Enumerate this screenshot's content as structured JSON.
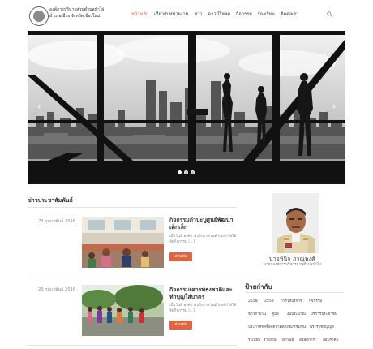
{
  "site": {
    "name_line1": "องค์การบริหารส่วนตำบลป่าไผ่",
    "name_line2": "อำเภอเมือง จังหวัดเชียงใหม่"
  },
  "nav": {
    "items": [
      "หน้าหลัก",
      "เกี่ยวกับหน่วยงาน",
      "ข่าว",
      "ดาวน์โหลด",
      "กิจกรรม",
      "ร้องเรียน",
      "ติดต่อเรา"
    ],
    "active_index": 0
  },
  "slider": {
    "prev_label": "‹",
    "next_label": "›",
    "dot_count": 3,
    "active_dot": 0
  },
  "news": {
    "section_title": "ข่าวประชาสัมพันธ์",
    "posts": [
      {
        "date": "23 กุมภาพันธ์ 2016",
        "title": "กิจกรรมกำปะปูศูนย์พัฒนาเด็กเล็ก",
        "excerpt": "เมื่อวันที่ องค์การบริหารส่วนตำบลป่าไผ่ได้จัดกิจกรรม [...]",
        "button": "อ่านต่อ"
      },
      {
        "date": "23 กุมภาพันธ์ 2016",
        "title": "กิจกรรมเคารพธงชาติและทำบุญใส่บาตร",
        "excerpt": "เมื่อวันที่ องค์การบริหารส่วนตำบลป่าไผ่ได้จัดกิจกรรม [...]",
        "button": "อ่านต่อ"
      }
    ]
  },
  "profile": {
    "name": "นายพินิจ ภาณุพงศ์",
    "role": "นายกองค์การบริหารส่วนตำบลป่าไผ่"
  },
  "tags": {
    "title": "ป้ายกำกับ",
    "items": [
      "2558",
      "2559",
      "การให้บริการ",
      "กิจกรรม",
      "ข่าวภายใน",
      "คู่มือ",
      "งบประมาณ",
      "บริการประชาชน",
      "ประกาศจัดซื้อจัดจ้าง",
      "ผลิตภัณฑ์ชุมชน",
      "พระราชบัญญัติ",
      "ระเบียบ",
      "รายงาน",
      "สถานที่",
      "สวัสดิการ",
      "สอบราคา"
    ]
  },
  "colors": {
    "accent": "#e0643f"
  }
}
